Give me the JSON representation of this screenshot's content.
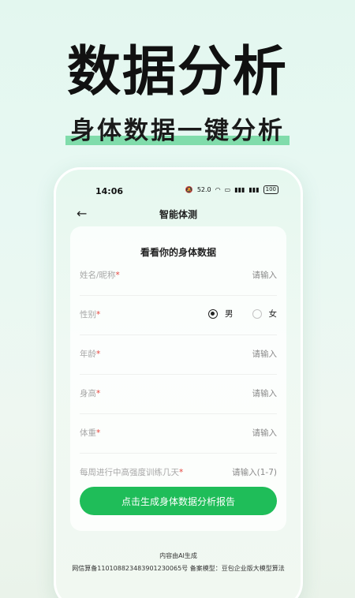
{
  "hero": {
    "title": "数据分析",
    "subtitle": "身体数据一键分析"
  },
  "status": {
    "time": "14:06",
    "speed": "52.0",
    "battery": "100"
  },
  "nav": {
    "title": "智能体测"
  },
  "form": {
    "title": "看看你的身体数据",
    "name": {
      "label": "姓名/昵称",
      "placeholder": "请输入"
    },
    "gender": {
      "label": "性别",
      "options": [
        "男",
        "女"
      ],
      "selected": "男"
    },
    "age": {
      "label": "年龄",
      "placeholder": "请输入"
    },
    "height": {
      "label": "身高",
      "placeholder": "请输入"
    },
    "weight": {
      "label": "体重",
      "placeholder": "请输入"
    },
    "training": {
      "label": "每周进行中高强度训练几天",
      "placeholder": "请输入(1-7)"
    },
    "required_mark": "*",
    "submit": "点击生成身体数据分析报告"
  },
  "footer": {
    "line1": "内容由AI生成",
    "line2": "网信算备110108823483901230065号  备案模型：豆包企业版大模型算法"
  },
  "colors": {
    "accent": "#1fbd59",
    "required": "#e5433c",
    "highlight": "#5dd393"
  }
}
